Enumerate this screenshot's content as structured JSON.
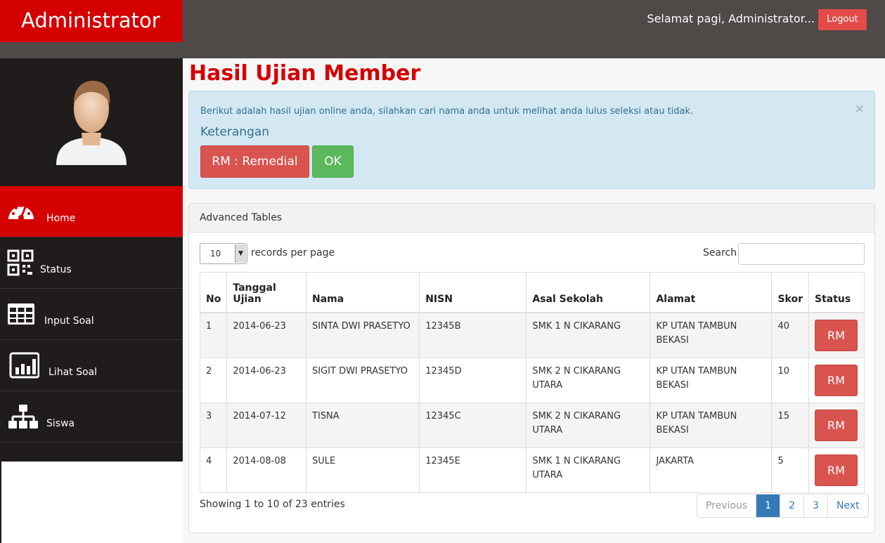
{
  "header": {
    "brand": "Administrator",
    "greeting": "Selamat pagi, Administrator...",
    "logout_label": "Logout"
  },
  "sidebar": {
    "items": [
      {
        "label": "Home",
        "icon": "dashboard-gauge-icon",
        "active": true
      },
      {
        "label": "Status",
        "icon": "qr-code-icon"
      },
      {
        "label": "Input Soal",
        "icon": "table-grid-icon"
      },
      {
        "label": "Lihat Soal",
        "icon": "bar-chart-icon"
      },
      {
        "label": "Siswa",
        "icon": "sitemap-icon"
      }
    ]
  },
  "main": {
    "title": "Hasil Ujian Member",
    "alert": {
      "text": "Berikut adalah hasil ujian online anda, silahkan cari nama anda untuk melihat anda lulus seleksi atau tidak.",
      "close": "×",
      "subtitle": "Keterangan",
      "rm_label": "RM : Remedial",
      "ok_label": "OK"
    },
    "panel": {
      "title": "Advanced Tables",
      "length_value": "10",
      "length_label": "records per page",
      "search_label": "Search:",
      "search_value": "",
      "columns": [
        "No",
        "Tanggal Ujian",
        "Nama",
        "NISN",
        "Asal Sekolah",
        "Alamat",
        "Skor",
        "Status"
      ],
      "rows": [
        {
          "no": "1",
          "tanggal": "2014-06-23",
          "nama": "SINTA DWI PRASETYO",
          "nisn": "12345B",
          "sekolah": "SMK 1 N CIKARANG",
          "alamat": "KP UTAN TAMBUN BEKASI",
          "skor": "40",
          "status": "RM"
        },
        {
          "no": "2",
          "tanggal": "2014-06-23",
          "nama": "SIGIT DWI PRASETYO",
          "nisn": "12345D",
          "sekolah": "SMK 2 N CIKARANG UTARA",
          "alamat": "KP UTAN TAMBUN BEKASI",
          "skor": "10",
          "status": "RM"
        },
        {
          "no": "3",
          "tanggal": "2014-07-12",
          "nama": "TISNA",
          "nisn": "12345C",
          "sekolah": "SMK 2 N CIKARANG UTARA",
          "alamat": "KP UTAN TAMBUN BEKASI",
          "skor": "15",
          "status": "RM"
        },
        {
          "no": "4",
          "tanggal": "2014-08-08",
          "nama": "SULE",
          "nisn": "12345E",
          "sekolah": "SMK 1 N CIKARANG UTARA",
          "alamat": "JAKARTA",
          "skor": "5",
          "status": "RM"
        }
      ],
      "info": "Showing 1 to 10 of 23 entries",
      "pagination": {
        "previous": "Previous",
        "pages": [
          "1",
          "2",
          "3"
        ],
        "current": "1",
        "next": "Next"
      }
    }
  },
  "colors": {
    "brand_red": "#d50000",
    "topbar": "#4f4947",
    "sidebar": "#201c1b",
    "danger": "#d9534f",
    "success": "#5cb85c",
    "info_bg": "#d3e8f2",
    "primary": "#337ab7"
  }
}
